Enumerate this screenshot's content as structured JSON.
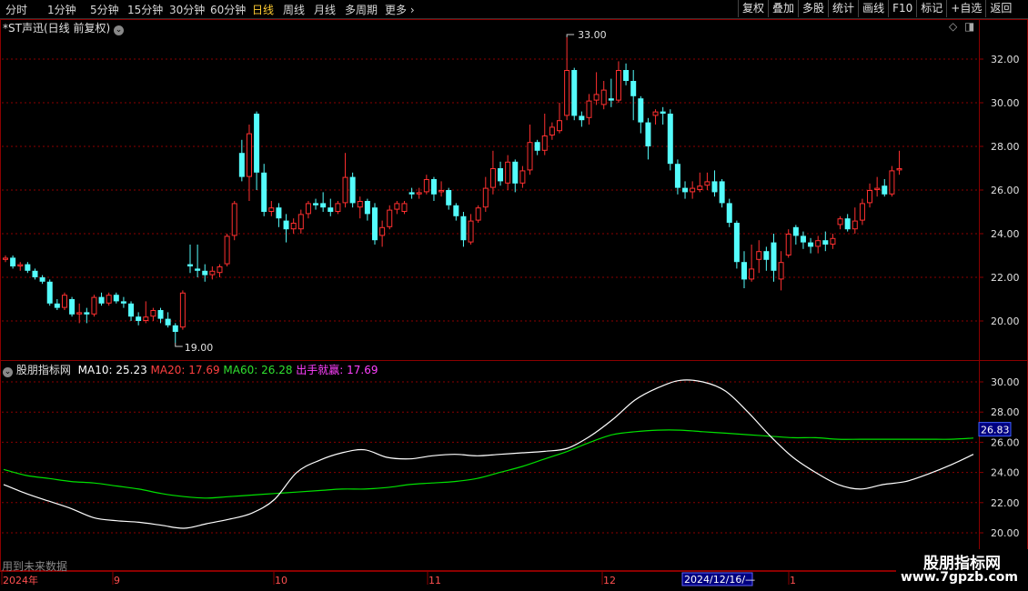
{
  "toolbar": {
    "periods": [
      "分时",
      "1分钟",
      "5分钟",
      "15分钟",
      "30分钟",
      "60分钟",
      "日线",
      "周线",
      "月线",
      "多周期",
      "更多"
    ],
    "active": "日线",
    "right_buttons": [
      "复权",
      "叠加",
      "多股",
      "统计",
      "画线",
      "F10",
      "标记",
      "+自选",
      "返回"
    ]
  },
  "stock": {
    "title": "*ST声迅(日线 前复权)"
  },
  "price_axis": {
    "ticks": [
      "32.00",
      "30.00",
      "28.00",
      "26.00",
      "24.00",
      "22.00",
      "20.00"
    ]
  },
  "annotations": {
    "high": "33.00",
    "low": "19.00"
  },
  "indicator": {
    "name": "股朋指标网",
    "ma10_label": "MA10: 25.23",
    "ma20_label": "MA20: 17.69",
    "ma60_label": "MA60: 26.28",
    "signal_label": "出手就赢: 17.69",
    "ticks": [
      "30.00",
      "28.00",
      "26.00",
      "24.00",
      "22.00",
      "20.00"
    ],
    "current_value": "26.83"
  },
  "footer": {
    "note": "用到未来数据"
  },
  "date_axis": {
    "labels": [
      "2024年",
      "9",
      "10",
      "11",
      "12",
      "1"
    ],
    "cursor": "2024/12/16/—"
  },
  "watermark": {
    "line1": "股朋指标网",
    "line2": "www.7gpzb.com"
  },
  "colors": {
    "up": "#ff3030",
    "down": "#54fcfc",
    "grid": "#8b0000",
    "ma_white": "#ffffff",
    "ma_green": "#00e000"
  },
  "chart_data": [
    {
      "type": "candlestick",
      "title": "*ST声迅(日线 前复权)",
      "ylim": [
        18.5,
        33.5
      ],
      "high_mark": 33.0,
      "low_mark": 19.0,
      "candles": [
        {
          "o": 22.8,
          "c": 22.9,
          "h": 23.0,
          "l": 22.7
        },
        {
          "o": 22.9,
          "c": 22.5,
          "h": 23.0,
          "l": 22.4
        },
        {
          "o": 22.5,
          "c": 22.6,
          "h": 22.7,
          "l": 22.3
        },
        {
          "o": 22.6,
          "c": 22.3,
          "h": 22.7,
          "l": 22.2
        },
        {
          "o": 22.3,
          "c": 22.0,
          "h": 22.4,
          "l": 21.9
        },
        {
          "o": 22.0,
          "c": 21.8,
          "h": 22.1,
          "l": 21.7
        },
        {
          "o": 21.8,
          "c": 20.8,
          "h": 21.9,
          "l": 20.7
        },
        {
          "o": 20.8,
          "c": 20.6,
          "h": 21.0,
          "l": 20.5
        },
        {
          "o": 20.6,
          "c": 21.2,
          "h": 21.3,
          "l": 20.5
        },
        {
          "o": 21.0,
          "c": 20.3,
          "h": 21.1,
          "l": 20.2
        },
        {
          "o": 20.3,
          "c": 20.4,
          "h": 20.8,
          "l": 19.9
        },
        {
          "o": 20.4,
          "c": 20.3,
          "h": 20.6,
          "l": 19.9
        },
        {
          "o": 20.3,
          "c": 21.1,
          "h": 21.2,
          "l": 20.2
        },
        {
          "o": 21.1,
          "c": 20.8,
          "h": 21.3,
          "l": 20.7
        },
        {
          "o": 20.8,
          "c": 21.2,
          "h": 21.3,
          "l": 20.7
        },
        {
          "o": 21.2,
          "c": 20.9,
          "h": 21.3,
          "l": 20.8
        },
        {
          "o": 20.9,
          "c": 20.8,
          "h": 21.1,
          "l": 20.6
        },
        {
          "o": 20.8,
          "c": 20.2,
          "h": 20.9,
          "l": 20.0
        },
        {
          "o": 20.2,
          "c": 20.0,
          "h": 20.4,
          "l": 19.8
        },
        {
          "o": 20.0,
          "c": 20.2,
          "h": 20.9,
          "l": 19.9
        },
        {
          "o": 20.2,
          "c": 20.5,
          "h": 20.6,
          "l": 20.0
        },
        {
          "o": 20.5,
          "c": 20.1,
          "h": 20.6,
          "l": 19.9
        },
        {
          "o": 20.1,
          "c": 19.8,
          "h": 20.4,
          "l": 19.7
        },
        {
          "o": 19.8,
          "c": 19.5,
          "h": 19.9,
          "l": 19.0
        },
        {
          "o": 19.7,
          "c": 21.3,
          "h": 21.4,
          "l": 19.6
        },
        {
          "o": 22.6,
          "c": 22.5,
          "h": 23.5,
          "l": 22.2
        },
        {
          "o": 22.4,
          "c": 22.3,
          "h": 23.5,
          "l": 22.0
        },
        {
          "o": 22.3,
          "c": 22.1,
          "h": 22.6,
          "l": 21.8
        },
        {
          "o": 22.1,
          "c": 22.3,
          "h": 22.5,
          "l": 21.9
        },
        {
          "o": 22.2,
          "c": 22.5,
          "h": 22.6,
          "l": 22.0
        },
        {
          "o": 22.6,
          "c": 23.9,
          "h": 24.0,
          "l": 22.5
        },
        {
          "o": 23.9,
          "c": 25.4,
          "h": 25.5,
          "l": 23.7
        },
        {
          "o": 27.7,
          "c": 26.6,
          "h": 28.3,
          "l": 26.4
        },
        {
          "o": 26.6,
          "c": 28.6,
          "h": 29.0,
          "l": 25.5
        },
        {
          "o": 29.5,
          "c": 26.8,
          "h": 29.6,
          "l": 26.0
        },
        {
          "o": 26.8,
          "c": 25.0,
          "h": 27.2,
          "l": 24.8
        },
        {
          "o": 25.0,
          "c": 25.2,
          "h": 25.5,
          "l": 24.8
        },
        {
          "o": 25.2,
          "c": 24.7,
          "h": 25.4,
          "l": 24.3
        },
        {
          "o": 24.6,
          "c": 24.2,
          "h": 24.9,
          "l": 23.6
        },
        {
          "o": 24.2,
          "c": 24.5,
          "h": 24.7,
          "l": 24.0
        },
        {
          "o": 24.2,
          "c": 24.9,
          "h": 25.1,
          "l": 24.0
        },
        {
          "o": 24.9,
          "c": 25.4,
          "h": 25.5,
          "l": 24.7
        },
        {
          "o": 25.4,
          "c": 25.3,
          "h": 25.6,
          "l": 25.1
        },
        {
          "o": 25.4,
          "c": 25.2,
          "h": 25.9,
          "l": 25.0
        },
        {
          "o": 25.2,
          "c": 25.0,
          "h": 25.6,
          "l": 24.8
        },
        {
          "o": 25.0,
          "c": 25.4,
          "h": 25.5,
          "l": 24.9
        },
        {
          "o": 25.4,
          "c": 26.6,
          "h": 27.7,
          "l": 25.2
        },
        {
          "o": 26.6,
          "c": 25.4,
          "h": 26.8,
          "l": 25.2
        },
        {
          "o": 25.2,
          "c": 25.5,
          "h": 25.7,
          "l": 24.7
        },
        {
          "o": 25.5,
          "c": 24.9,
          "h": 25.6,
          "l": 24.6
        },
        {
          "o": 25.2,
          "c": 23.7,
          "h": 25.4,
          "l": 23.5
        },
        {
          "o": 23.9,
          "c": 24.3,
          "h": 24.6,
          "l": 23.4
        },
        {
          "o": 24.3,
          "c": 25.1,
          "h": 25.3,
          "l": 24.2
        },
        {
          "o": 25.1,
          "c": 25.4,
          "h": 25.5,
          "l": 24.9
        },
        {
          "o": 25.0,
          "c": 25.4,
          "h": 25.5,
          "l": 24.9
        },
        {
          "o": 25.9,
          "c": 25.8,
          "h": 26.1,
          "l": 25.6
        },
        {
          "o": 25.8,
          "c": 25.9,
          "h": 26.1,
          "l": 25.6
        },
        {
          "o": 25.9,
          "c": 26.5,
          "h": 26.7,
          "l": 25.8
        },
        {
          "o": 26.5,
          "c": 25.8,
          "h": 26.6,
          "l": 25.5
        },
        {
          "o": 25.9,
          "c": 26.0,
          "h": 26.4,
          "l": 25.7
        },
        {
          "o": 26.0,
          "c": 25.3,
          "h": 26.1,
          "l": 25.1
        },
        {
          "o": 25.3,
          "c": 24.8,
          "h": 25.4,
          "l": 24.6
        },
        {
          "o": 24.8,
          "c": 23.7,
          "h": 25.0,
          "l": 23.4
        },
        {
          "o": 23.6,
          "c": 24.6,
          "h": 24.9,
          "l": 23.5
        },
        {
          "o": 24.6,
          "c": 25.2,
          "h": 25.3,
          "l": 24.5
        },
        {
          "o": 25.2,
          "c": 26.1,
          "h": 26.6,
          "l": 25.0
        },
        {
          "o": 26.1,
          "c": 27.0,
          "h": 27.8,
          "l": 25.8
        },
        {
          "o": 27.0,
          "c": 26.4,
          "h": 27.3,
          "l": 26.2
        },
        {
          "o": 26.3,
          "c": 27.3,
          "h": 27.6,
          "l": 26.0
        },
        {
          "o": 27.3,
          "c": 26.3,
          "h": 27.4,
          "l": 25.9
        },
        {
          "o": 26.3,
          "c": 26.9,
          "h": 27.1,
          "l": 26.1
        },
        {
          "o": 26.9,
          "c": 28.2,
          "h": 29.0,
          "l": 26.7
        },
        {
          "o": 28.2,
          "c": 27.8,
          "h": 28.3,
          "l": 27.6
        },
        {
          "o": 27.8,
          "c": 28.5,
          "h": 29.5,
          "l": 27.6
        },
        {
          "o": 28.5,
          "c": 28.9,
          "h": 29.1,
          "l": 28.3
        },
        {
          "o": 28.7,
          "c": 29.2,
          "h": 30.0,
          "l": 28.6
        },
        {
          "o": 29.4,
          "c": 31.5,
          "h": 33.0,
          "l": 29.2
        },
        {
          "o": 31.5,
          "c": 29.4,
          "h": 31.6,
          "l": 29.2
        },
        {
          "o": 29.4,
          "c": 29.2,
          "h": 29.6,
          "l": 28.9
        },
        {
          "o": 29.3,
          "c": 30.1,
          "h": 30.4,
          "l": 29.0
        },
        {
          "o": 30.1,
          "c": 30.4,
          "h": 31.4,
          "l": 29.9
        },
        {
          "o": 29.9,
          "c": 30.6,
          "h": 31.0,
          "l": 29.7
        },
        {
          "o": 30.2,
          "c": 30.1,
          "h": 31.1,
          "l": 29.8
        },
        {
          "o": 30.1,
          "c": 31.5,
          "h": 31.9,
          "l": 30.0
        },
        {
          "o": 31.5,
          "c": 31.0,
          "h": 31.8,
          "l": 30.8
        },
        {
          "o": 31.0,
          "c": 30.3,
          "h": 31.5,
          "l": 29.2
        },
        {
          "o": 30.2,
          "c": 29.1,
          "h": 30.3,
          "l": 28.6
        },
        {
          "o": 29.1,
          "c": 28.0,
          "h": 29.3,
          "l": 27.4
        },
        {
          "o": 29.4,
          "c": 29.6,
          "h": 29.7,
          "l": 29.0
        },
        {
          "o": 29.6,
          "c": 29.5,
          "h": 29.8,
          "l": 29.0
        },
        {
          "o": 29.5,
          "c": 27.2,
          "h": 29.7,
          "l": 26.9
        },
        {
          "o": 27.2,
          "c": 26.1,
          "h": 27.4,
          "l": 25.8
        },
        {
          "o": 26.1,
          "c": 25.9,
          "h": 26.4,
          "l": 25.6
        },
        {
          "o": 25.9,
          "c": 26.1,
          "h": 26.4,
          "l": 25.6
        },
        {
          "o": 26.0,
          "c": 26.2,
          "h": 26.8,
          "l": 25.9
        },
        {
          "o": 26.2,
          "c": 26.4,
          "h": 26.8,
          "l": 26.0
        },
        {
          "o": 26.4,
          "c": 25.9,
          "h": 26.9,
          "l": 25.7
        },
        {
          "o": 26.4,
          "c": 25.4,
          "h": 26.5,
          "l": 25.2
        },
        {
          "o": 25.4,
          "c": 24.5,
          "h": 25.6,
          "l": 24.3
        },
        {
          "o": 24.5,
          "c": 22.7,
          "h": 24.6,
          "l": 22.4
        },
        {
          "o": 22.7,
          "c": 21.9,
          "h": 23.2,
          "l": 21.5
        },
        {
          "o": 21.9,
          "c": 22.4,
          "h": 23.5,
          "l": 21.8
        },
        {
          "o": 22.8,
          "c": 23.2,
          "h": 23.7,
          "l": 22.2
        },
        {
          "o": 23.2,
          "c": 22.8,
          "h": 23.4,
          "l": 22.3
        },
        {
          "o": 23.6,
          "c": 22.3,
          "h": 24.0,
          "l": 21.8
        },
        {
          "o": 21.9,
          "c": 22.7,
          "h": 23.2,
          "l": 21.4
        },
        {
          "o": 23.0,
          "c": 24.0,
          "h": 24.2,
          "l": 22.9
        },
        {
          "o": 24.3,
          "c": 23.9,
          "h": 24.4,
          "l": 23.5
        },
        {
          "o": 23.9,
          "c": 23.6,
          "h": 24.1,
          "l": 23.3
        },
        {
          "o": 23.6,
          "c": 23.4,
          "h": 23.8,
          "l": 23.1
        },
        {
          "o": 23.4,
          "c": 23.7,
          "h": 23.9,
          "l": 23.1
        },
        {
          "o": 23.7,
          "c": 23.5,
          "h": 24.1,
          "l": 23.2
        },
        {
          "o": 23.5,
          "c": 23.8,
          "h": 24.0,
          "l": 23.3
        },
        {
          "o": 24.4,
          "c": 24.7,
          "h": 24.8,
          "l": 24.2
        },
        {
          "o": 24.7,
          "c": 24.2,
          "h": 24.9,
          "l": 24.1
        },
        {
          "o": 24.2,
          "c": 24.6,
          "h": 25.2,
          "l": 24.0
        },
        {
          "o": 24.6,
          "c": 25.4,
          "h": 25.6,
          "l": 24.4
        },
        {
          "o": 25.4,
          "c": 26.0,
          "h": 26.3,
          "l": 25.2
        },
        {
          "o": 26.0,
          "c": 26.1,
          "h": 26.6,
          "l": 25.7
        },
        {
          "o": 26.2,
          "c": 25.8,
          "h": 26.5,
          "l": 25.7
        },
        {
          "o": 25.8,
          "c": 26.9,
          "h": 27.1,
          "l": 25.7
        },
        {
          "o": 26.9,
          "c": 27.0,
          "h": 27.8,
          "l": 26.7
        }
      ]
    },
    {
      "type": "line",
      "title": "股朋指标网",
      "ylim": [
        19.5,
        31.2
      ],
      "series": [
        {
          "name": "MA10",
          "values": [
            23.2,
            22.6,
            22.1,
            21.6,
            21.0,
            20.8,
            20.7,
            20.5,
            20.3,
            20.6,
            20.9,
            21.3,
            22.2,
            24.0,
            24.8,
            25.3,
            25.5,
            25.0,
            24.9,
            25.1,
            25.2,
            25.1,
            25.2,
            25.3,
            25.4,
            25.6,
            26.4,
            27.5,
            28.8,
            29.6,
            30.1,
            30.0,
            29.4,
            28.0,
            26.4,
            25.0,
            24.0,
            23.2,
            22.9,
            23.2,
            23.4,
            23.9,
            24.5,
            25.2
          ]
        },
        {
          "name": "MA60",
          "values": [
            24.2,
            23.8,
            23.6,
            23.4,
            23.3,
            23.1,
            22.9,
            22.6,
            22.4,
            22.3,
            22.4,
            22.5,
            22.6,
            22.7,
            22.8,
            22.9,
            22.9,
            23.0,
            23.2,
            23.3,
            23.4,
            23.6,
            24.0,
            24.4,
            24.9,
            25.4,
            26.0,
            26.5,
            26.7,
            26.8,
            26.8,
            26.7,
            26.6,
            26.5,
            26.4,
            26.3,
            26.3,
            26.2,
            26.2,
            26.2,
            26.2,
            26.2,
            26.2,
            26.28
          ]
        }
      ]
    }
  ]
}
